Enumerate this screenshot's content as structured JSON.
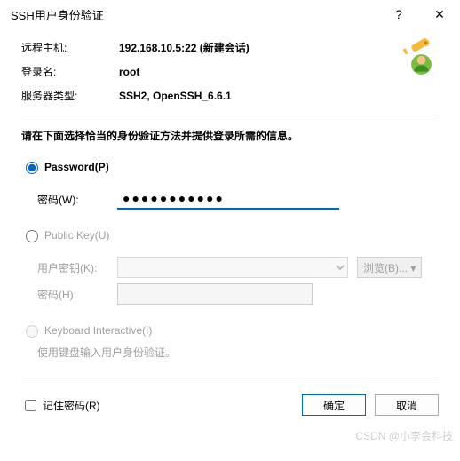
{
  "titlebar": {
    "title": "SSH用户身份验证"
  },
  "info": {
    "host_label": "远程主机:",
    "host_value": "192.168.10.5:22 (新建会话)",
    "login_label": "登录名:",
    "login_value": "root",
    "type_label": "服务器类型:",
    "type_value": "SSH2, OpenSSH_6.6.1"
  },
  "instruction": "请在下面选择恰当的身份验证方法并提供登录所需的信息。",
  "password": {
    "radio_label": "Password(P)",
    "field_label": "密码(W):",
    "value": "●●●●●●●●●●●"
  },
  "publickey": {
    "radio_label": "Public Key(U)",
    "key_label": "用户密钥(K):",
    "browse_label": "浏览(B)...",
    "pw_label": "密码(H):"
  },
  "keyboard_interactive": {
    "radio_label": "Keyboard Interactive(I)",
    "desc": "使用键盘输入用户身份验证。"
  },
  "remember_label": "记住密码(R)",
  "buttons": {
    "ok": "确定",
    "cancel": "取消"
  },
  "watermark": "CSDN @小李会科技",
  "chevron": "▾"
}
